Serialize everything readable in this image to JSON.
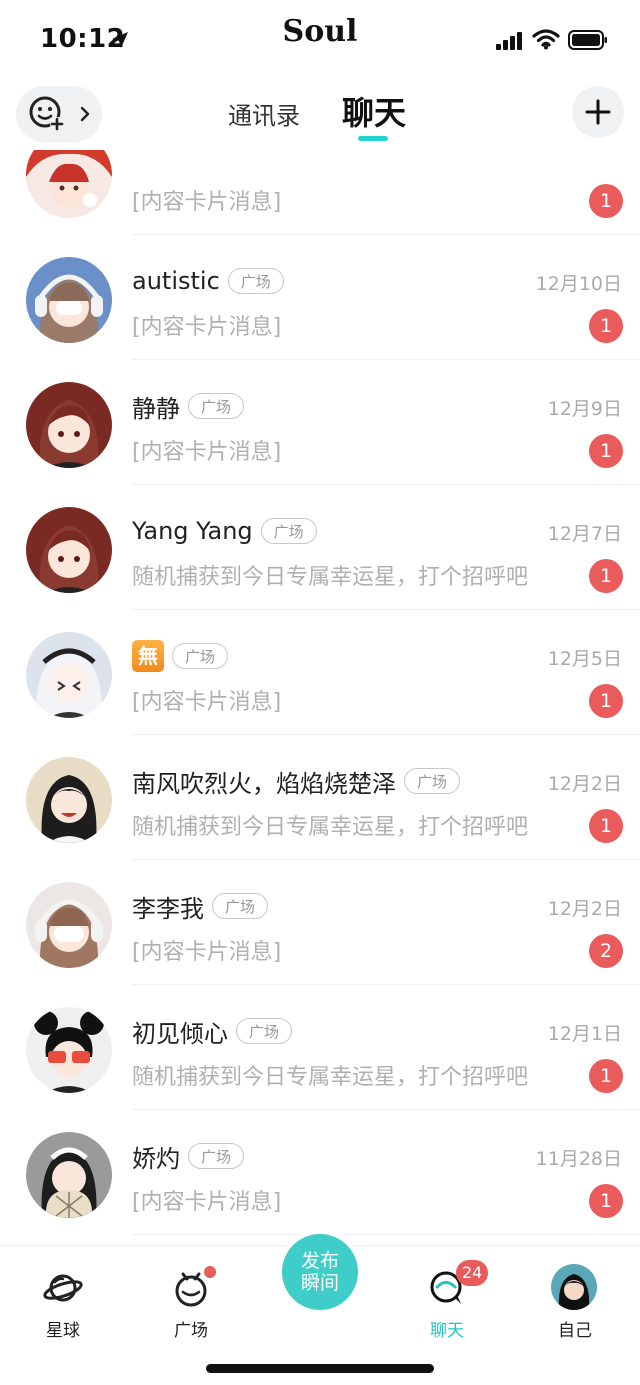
{
  "status_bar": {
    "time": "10:12",
    "brand": "Soul"
  },
  "header": {
    "tabs": [
      {
        "label": "通讯录",
        "active": false
      },
      {
        "label": "聊天",
        "active": true
      }
    ],
    "accent_color": "#25d4d0"
  },
  "chats": [
    {
      "name": "",
      "tag": "",
      "date": "",
      "message": "[内容卡片消息]",
      "unread": "1"
    },
    {
      "name": "autistic",
      "tag": "广场",
      "date": "12月10日",
      "message": "[内容卡片消息]",
      "unread": "1"
    },
    {
      "name": "静静",
      "tag": "广场",
      "date": "12月9日",
      "message": "[内容卡片消息]",
      "unread": "1"
    },
    {
      "name": "Yang Yang",
      "tag": "广场",
      "date": "12月7日",
      "message": "随机捕获到今日专属幸运星，打个招呼吧",
      "unread": "1"
    },
    {
      "name": "無",
      "tag": "广场",
      "date": "12月5日",
      "message": "[内容卡片消息]",
      "unread": "1"
    },
    {
      "name": "南风吹烈火，焰焰烧楚泽",
      "tag": "广场",
      "date": "12月2日",
      "message": "随机捕获到今日专属幸运星，打个招呼吧",
      "unread": "1"
    },
    {
      "name": "李李我",
      "tag": "广场",
      "date": "12月2日",
      "message": "[内容卡片消息]",
      "unread": "2"
    },
    {
      "name": "初见倾心",
      "tag": "广场",
      "date": "12月1日",
      "message": "随机捕获到今日专属幸运星，打个招呼吧",
      "unread": "1"
    },
    {
      "name": "娇灼",
      "tag": "广场",
      "date": "11月28日",
      "message": "[内容卡片消息]",
      "unread": "1"
    }
  ],
  "bottom_nav": {
    "items": [
      {
        "label": "星球",
        "icon": "planet-icon"
      },
      {
        "label": "广场",
        "icon": "square-icon"
      },
      {
        "label": "聊天",
        "icon": "chat-icon",
        "count": "24",
        "active": true
      },
      {
        "label": "自己",
        "icon": "profile-avatar"
      }
    ],
    "publish_line1": "发布",
    "publish_line2": "瞬间"
  },
  "colors": {
    "badge": "#ea5b5b",
    "accent": "#3ecdc8"
  }
}
